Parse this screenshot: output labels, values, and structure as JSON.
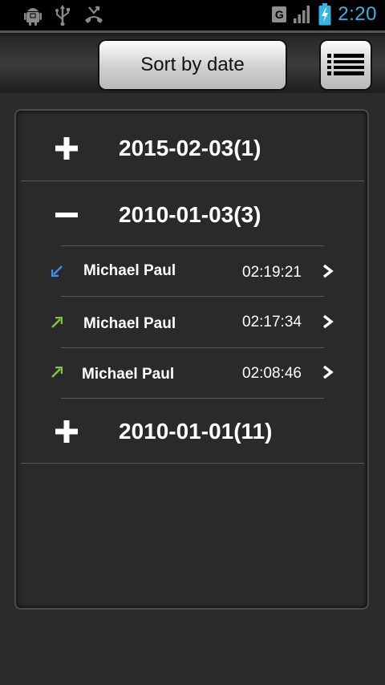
{
  "status_bar": {
    "network_type": "G",
    "time": "2:20",
    "left_icons": [
      "android-debug-icon",
      "usb-icon",
      "missed-call-icon"
    ],
    "right_icons": [
      "network-g-icon",
      "signal-icon",
      "battery-charging-icon"
    ]
  },
  "toolbar": {
    "sort_label": "Sort by date",
    "menu_icon": "list-menu-icon"
  },
  "groups": [
    {
      "label": "2015-02-03(1)",
      "state": "collapsed",
      "icon": "expand-plus-icon"
    },
    {
      "label": "2010-01-03(3)",
      "state": "expanded",
      "icon": "collapse-minus-icon",
      "calls": [
        {
          "name": "Michael Paul",
          "time": "02:19:21",
          "direction": "incoming",
          "icon": "incoming-call-arrow-icon",
          "color": "#3d8fe8"
        },
        {
          "name": "Michael Paul",
          "time": "02:17:34",
          "direction": "outgoing",
          "icon": "outgoing-call-arrow-icon",
          "color": "#7ccc2b"
        },
        {
          "name": "Michael Paul",
          "time": "02:08:46",
          "direction": "outgoing",
          "icon": "outgoing-call-arrow-icon",
          "color": "#7ccc2b"
        }
      ]
    },
    {
      "label": "2010-01-01(11)",
      "state": "collapsed",
      "icon": "expand-plus-icon"
    }
  ],
  "colors": {
    "clock": "#33b5e5",
    "incoming": "#3d8fe8",
    "outgoing": "#7ccc2b"
  }
}
